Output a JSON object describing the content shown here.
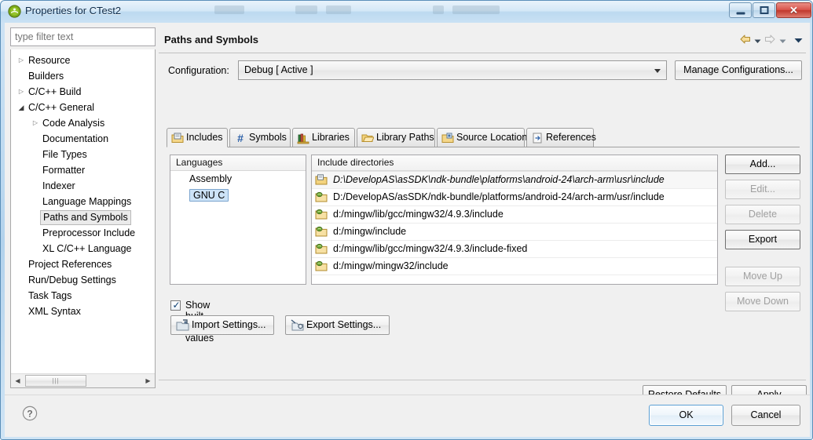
{
  "window": {
    "title": "Properties for CTest2",
    "icon": "eclipse-green-circle-icon",
    "controls": {
      "minimize": "minimize-button",
      "maximize": "restore-button",
      "close_glyph": "✕"
    }
  },
  "filter": {
    "placeholder": "type filter text",
    "value": ""
  },
  "tree": {
    "items": [
      {
        "label": "Resource",
        "indent": 0,
        "arrow": "collapsed",
        "selected": false
      },
      {
        "label": "Builders",
        "indent": 0,
        "arrow": "none",
        "selected": false
      },
      {
        "label": "C/C++ Build",
        "indent": 0,
        "arrow": "collapsed",
        "selected": false
      },
      {
        "label": "C/C++ General",
        "indent": 0,
        "arrow": "expanded",
        "selected": false
      },
      {
        "label": "Code Analysis",
        "indent": 1,
        "arrow": "collapsed",
        "selected": false
      },
      {
        "label": "Documentation",
        "indent": 1,
        "arrow": "none",
        "selected": false
      },
      {
        "label": "File Types",
        "indent": 1,
        "arrow": "none",
        "selected": false
      },
      {
        "label": "Formatter",
        "indent": 1,
        "arrow": "none",
        "selected": false
      },
      {
        "label": "Indexer",
        "indent": 1,
        "arrow": "none",
        "selected": false
      },
      {
        "label": "Language Mappings",
        "indent": 1,
        "arrow": "none",
        "selected": false
      },
      {
        "label": "Paths and Symbols",
        "indent": 1,
        "arrow": "none",
        "selected": true
      },
      {
        "label": "Preprocessor Include",
        "indent": 1,
        "arrow": "none",
        "selected": false
      },
      {
        "label": "XL C/C++ Language",
        "indent": 1,
        "arrow": "none",
        "selected": false
      },
      {
        "label": "Project References",
        "indent": 0,
        "arrow": "none",
        "selected": false
      },
      {
        "label": "Run/Debug Settings",
        "indent": 0,
        "arrow": "none",
        "selected": false
      },
      {
        "label": "Task Tags",
        "indent": 0,
        "arrow": "none",
        "selected": false
      },
      {
        "label": "XML Syntax",
        "indent": 0,
        "arrow": "none",
        "selected": false
      }
    ],
    "scrollbar": {
      "left_glyph": "◀",
      "right_glyph": "▶",
      "thumb_grip": "|||"
    }
  },
  "page": {
    "title": "Paths and Symbols",
    "nav": {
      "back": "back-arrow-icon",
      "back_menu": "back-history-dropdown",
      "forward": "forward-arrow-icon",
      "forward_menu": "forward-history-dropdown",
      "view_menu": "view-menu-chevron"
    }
  },
  "configuration": {
    "label": "Configuration:",
    "value": "Debug  [ Active ]",
    "manage_label": "Manage Configurations..."
  },
  "tabs": [
    {
      "label": "Includes",
      "icon": "includes-folder-icon",
      "active": true
    },
    {
      "label": "Symbols",
      "icon": "hash-symbol-icon",
      "active": false
    },
    {
      "label": "Libraries",
      "icon": "books-library-icon",
      "active": false
    },
    {
      "label": "Library Paths",
      "icon": "open-folder-icon",
      "active": false
    },
    {
      "label": "Source Location",
      "icon": "source-folder-icon",
      "active": false
    },
    {
      "label": "References",
      "icon": "references-arrow-page-icon",
      "active": false
    }
  ],
  "languages": {
    "header": "Languages",
    "items": [
      {
        "label": "Assembly",
        "selected": false
      },
      {
        "label": "GNU C",
        "selected": true
      }
    ]
  },
  "includes": {
    "header": "Include directories",
    "rows": [
      {
        "path": "D:\\DevelopAS\\asSDK\\ndk-bundle\\platforms\\android-24\\arch-arm\\usr\\include",
        "icon": "user-include-folder-icon",
        "builtin": false
      },
      {
        "path": "D:/DevelopAS/asSDK/ndk-bundle/platforms/android-24/arch-arm/usr/include",
        "icon": "builtin-include-folder-icon",
        "builtin": true
      },
      {
        "path": "d:/mingw/lib/gcc/mingw32/4.9.3/include",
        "icon": "builtin-include-folder-icon",
        "builtin": true
      },
      {
        "path": "d:/mingw/include",
        "icon": "builtin-include-folder-icon",
        "builtin": true
      },
      {
        "path": "d:/mingw/lib/gcc/mingw32/4.9.3/include-fixed",
        "icon": "builtin-include-folder-icon",
        "builtin": true
      },
      {
        "path": "d:/mingw/mingw32/include",
        "icon": "builtin-include-folder-icon",
        "builtin": true
      }
    ]
  },
  "side_buttons": [
    {
      "label": "Add...",
      "enabled": true,
      "default": true
    },
    {
      "label": "Edit...",
      "enabled": false,
      "default": false
    },
    {
      "label": "Delete",
      "enabled": false,
      "default": false
    },
    {
      "label": "Export",
      "enabled": true,
      "default": true
    },
    {
      "label": "Move Up",
      "enabled": false,
      "default": false
    },
    {
      "label": "Move Down",
      "enabled": false,
      "default": false
    }
  ],
  "options": {
    "show_builtin_label": "Show built-in values",
    "show_builtin_checked": true,
    "check_glyph": "✓",
    "import_label": "Import Settings...",
    "export_label": "Export Settings..."
  },
  "footer": {
    "restore_label": "Restore Defaults",
    "restore_mnemonic": "D",
    "apply_label": "Apply",
    "apply_mnemonic": "A",
    "help": "help-question-icon",
    "ok_label": "OK",
    "cancel_label": "Cancel"
  },
  "colors": {
    "title_bar": "#bcd9f0",
    "dialog_bg": "#f0f0f0",
    "selection_blue": "#cde3f7",
    "close_red": "#d9534a",
    "default_button_border": "#5a9fd4"
  }
}
